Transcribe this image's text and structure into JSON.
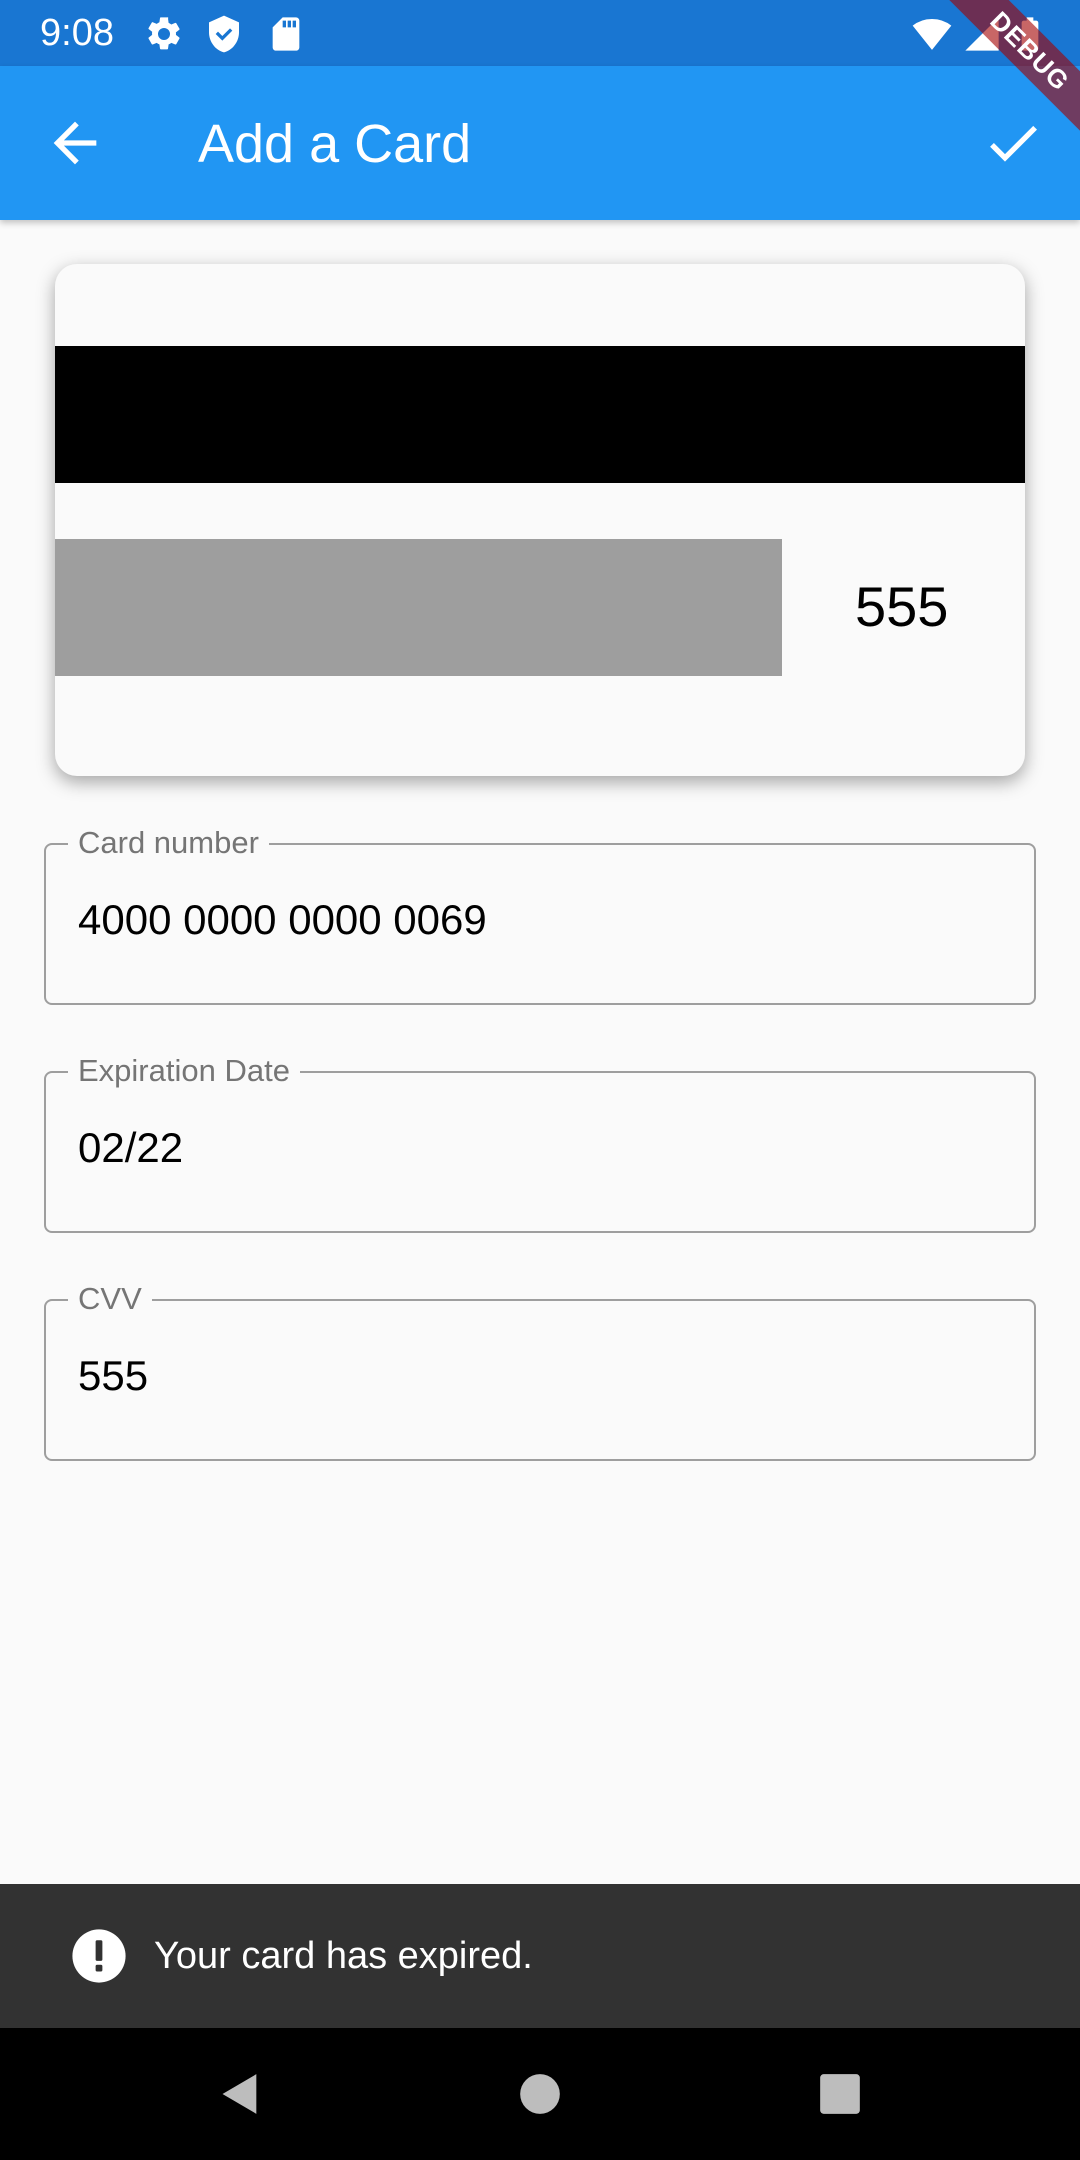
{
  "status_bar": {
    "time": "9:08",
    "left_icons": [
      "gear-icon",
      "shield-icon",
      "sd-card-icon"
    ],
    "right_icons": [
      "wifi-icon",
      "cell-signal-icon",
      "battery-icon"
    ]
  },
  "debug_banner": "DEBUG",
  "app_bar": {
    "title": "Add a Card",
    "back_icon": "arrow-back-icon",
    "confirm_icon": "check-icon",
    "color": "#2196f3",
    "status_color": "#1976d2"
  },
  "card_preview": {
    "cvv": "555"
  },
  "fields": {
    "card_number": {
      "label": "Card number",
      "value": "4000 0000 0000 0069"
    },
    "expiration": {
      "label": "Expiration Date",
      "value": "02/22"
    },
    "cvv": {
      "label": "CVV",
      "value": "555"
    }
  },
  "snackbar": {
    "message": "Your card has expired.",
    "icon": "error-icon"
  },
  "nav_bar": {
    "buttons": [
      "back-triangle-icon",
      "home-circle-icon",
      "recents-square-icon"
    ]
  }
}
